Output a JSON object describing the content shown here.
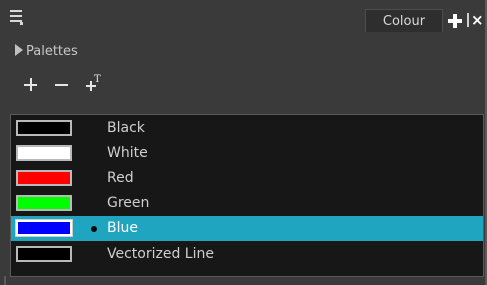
{
  "header": {
    "tab_label": "Colour",
    "menu_icon": "hamburger-menu-icon",
    "add_view_icon": "plus-icon",
    "close_view_icon": "close-icon"
  },
  "palettes": {
    "label": "Palettes",
    "expanded": false
  },
  "toolbar": {
    "add_icon": "plus-icon",
    "remove_icon": "minus-icon",
    "add_texture_icon": "add-texture-icon"
  },
  "colors": {
    "selected_row_bg": "#1fa5bf",
    "list_bg": "#171717",
    "panel_bg": "#3a3a3a"
  },
  "swatches": [
    {
      "name": "Black",
      "color": "#000000",
      "selected": false
    },
    {
      "name": "White",
      "color": "#ffffff",
      "selected": false
    },
    {
      "name": "Red",
      "color": "#ff0000",
      "selected": false
    },
    {
      "name": "Green",
      "color": "#00ff00",
      "selected": false
    },
    {
      "name": "Blue",
      "color": "#0000ff",
      "selected": true
    },
    {
      "name": "Vectorized Line",
      "color": "#000000",
      "selected": false
    }
  ]
}
